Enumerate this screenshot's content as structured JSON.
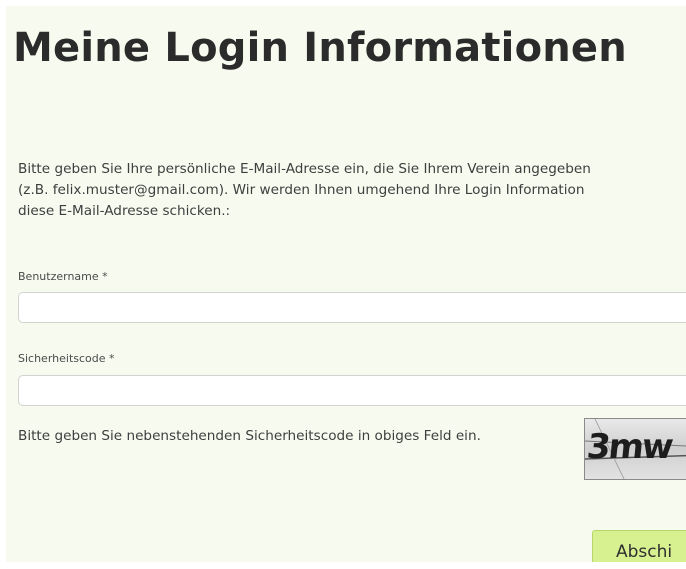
{
  "page": {
    "title": "Meine Login Informationen"
  },
  "intro": {
    "line1": "Bitte geben Sie Ihre persönliche E-Mail-Adresse ein, die Sie Ihrem Verein angegeben",
    "line2": "(z.B. felix.muster@gmail.com). Wir werden Ihnen umgehend Ihre Login Information",
    "line3": "diese E-Mail-Adresse schicken.:"
  },
  "form": {
    "username_label": "Benutzername *",
    "username_value": "",
    "security_label": "Sicherheitscode *",
    "security_value": "",
    "captcha_hint": "Bitte geben Sie nebenstehenden Sicherheitscode in obiges Feld ein.",
    "captcha_text": "3mw",
    "submit_label": "Abschi"
  },
  "colors": {
    "panel_background": "#f7fbef",
    "submit_background": "#d7f090"
  }
}
